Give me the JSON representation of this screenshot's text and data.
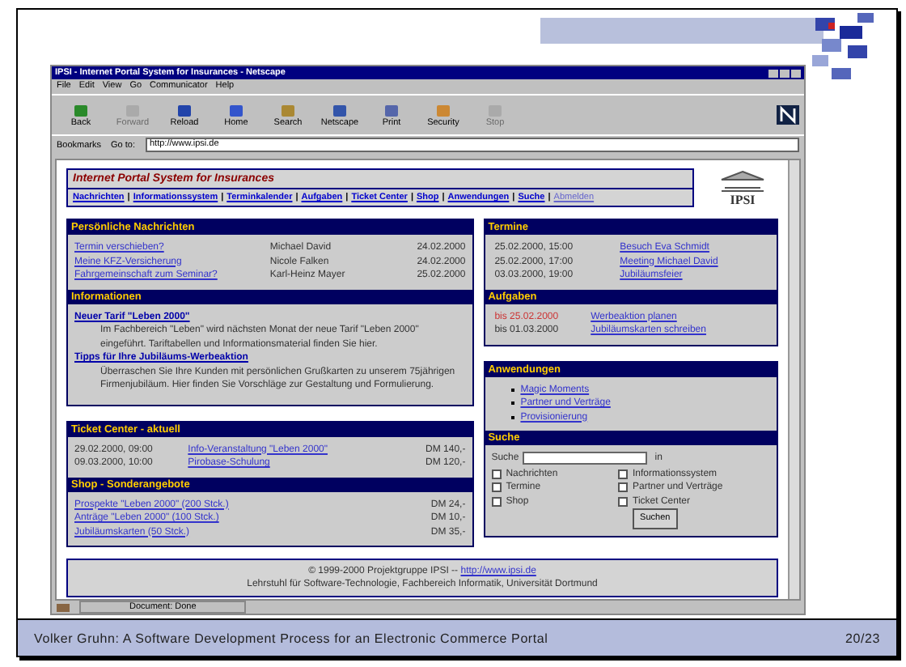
{
  "window": {
    "title": "IPSI - Internet Portal System for Insurances - Netscape",
    "menu": [
      "File",
      "Edit",
      "View",
      "Go",
      "Communicator",
      "Help"
    ],
    "toolbar": [
      {
        "label": "Back",
        "disabled": false
      },
      {
        "label": "Forward",
        "disabled": true
      },
      {
        "label": "Reload",
        "disabled": false
      },
      {
        "label": "Home",
        "disabled": false
      },
      {
        "label": "Search",
        "disabled": false
      },
      {
        "label": "Netscape",
        "disabled": false
      },
      {
        "label": "Print",
        "disabled": false
      },
      {
        "label": "Security",
        "disabled": false
      },
      {
        "label": "Stop",
        "disabled": true
      }
    ],
    "bookmarks": "Bookmarks",
    "goto_label": "Go to:",
    "url": "http://www.ipsi.de",
    "status": "Document: Done"
  },
  "header": {
    "title": "Internet Portal System for Insurances",
    "logo": "IPSI",
    "separator": "|",
    "nav": [
      {
        "label": "Nachrichten",
        "visited": false
      },
      {
        "label": "Informationssystem",
        "visited": false
      },
      {
        "label": "Terminkalender",
        "visited": false
      },
      {
        "label": "Aufgaben",
        "visited": false
      },
      {
        "label": "Ticket Center",
        "visited": false
      },
      {
        "label": "Shop",
        "visited": false
      },
      {
        "label": "Anwendungen",
        "visited": false
      },
      {
        "label": "Suche",
        "visited": false
      },
      {
        "label": "Abmelden",
        "visited": true
      }
    ]
  },
  "messages": {
    "title": "Persönliche Nachrichten",
    "rows": [
      {
        "subject": "Termin verschieben?",
        "sender": "Michael David",
        "date": "24.02.2000"
      },
      {
        "subject": "Meine KFZ-Versicherung",
        "sender": "Nicole Falken",
        "date": "24.02.2000"
      },
      {
        "subject": "Fahrgemeinschaft zum Seminar?",
        "sender": "Karl-Heinz Mayer",
        "date": "25.02.2000"
      }
    ]
  },
  "informationen": {
    "title": "Informationen",
    "items": [
      {
        "title": "Neuer Tarif \"Leben 2000\"",
        "text": "Im Fachbereich \"Leben\" wird nächsten Monat der neue Tarif \"Leben 2000\" eingeführt. Tariftabellen und Informationsmaterial finden Sie hier."
      },
      {
        "title": "Tipps für Ihre Jubiläums-Werbeaktion",
        "text": "Überraschen Sie Ihre Kunden mit persönlichen Grußkarten zu unserem 75jährigen Firmenjubiläum. Hier finden Sie Vorschläge zur Gestaltung und Formulierung."
      }
    ]
  },
  "ticket_center": {
    "title": "Ticket Center - aktuell",
    "rows": [
      {
        "date": "29.02.2000, 09:00",
        "event": "Info-Veranstaltung \"Leben 2000\"",
        "price": "DM 140,-"
      },
      {
        "date": "09.03.2000, 10:00",
        "event": "Pirobase-Schulung",
        "price": "DM 120,-"
      }
    ]
  },
  "shop": {
    "title": "Shop - Sonderangebote",
    "rows": [
      {
        "item": "Prospekte \"Leben 2000\" (200 Stck.)",
        "price": "DM 24,-"
      },
      {
        "item": "Anträge \"Leben 2000\" (100 Stck.)",
        "price": "DM 10,-"
      },
      {
        "item": "Jubiläumskarten (50 Stck.)",
        "price": "DM 35,-"
      }
    ]
  },
  "termine": {
    "title": "Termine",
    "rows": [
      {
        "datetime": "25.02.2000, 15:00",
        "title": "Besuch Eva Schmidt"
      },
      {
        "datetime": "25.02.2000, 17:00",
        "title": "Meeting Michael David"
      },
      {
        "datetime": "03.03.2000, 19:00",
        "title": "Jubiläumsfeier"
      }
    ]
  },
  "aufgaben": {
    "title": "Aufgaben",
    "rows": [
      {
        "deadline": "bis 25.02.2000",
        "task": "Werbeaktion planen",
        "overdue": true
      },
      {
        "deadline": "bis 01.03.2000",
        "task": "Jubiläumskarten schreiben",
        "overdue": false
      }
    ]
  },
  "anwendungen": {
    "title": "Anwendungen",
    "items": [
      "Magic Moments",
      "Partner und Verträge",
      "Provisionierung"
    ]
  },
  "suche": {
    "title": "Suche",
    "label": "Suche",
    "suffix": "in",
    "options": [
      {
        "label": "Nachrichten",
        "checked": false
      },
      {
        "label": "Informationssystem",
        "checked": false
      },
      {
        "label": "Termine",
        "checked": false
      },
      {
        "label": "Partner und Verträge",
        "checked": false
      },
      {
        "label": "Shop",
        "checked": false
      },
      {
        "label": "Ticket Center",
        "checked": false
      }
    ],
    "button": "Suchen"
  },
  "footer": {
    "copyright": "© 1999-2000 Projektgruppe IPSI --",
    "link": "http://www.ipsi.de",
    "line2": "Lehrstuhl für Software-Technologie, Fachbereich Informatik, Universität Dortmund"
  },
  "slide_footer": {
    "title": "Volker Gruhn: A Software Development Process for an Electronic Commerce Portal",
    "page": "20/23"
  }
}
